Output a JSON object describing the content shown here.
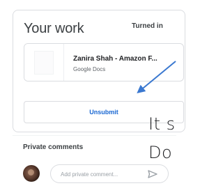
{
  "work_card": {
    "title": "Your work",
    "status": "Turned in",
    "attachment": {
      "title": "Zanira Shah - Amazon F...",
      "subtitle": "Google Docs"
    },
    "unsubmit_label": "Unsubmit"
  },
  "overlay_text": {
    "line1": "It s",
    "line2": "Do"
  },
  "private_comments": {
    "label": "Private comments",
    "placeholder": "Add private comment..."
  },
  "colors": {
    "accent": "#1967d2",
    "arrow": "#3a78d0",
    "border": "#dadce0"
  },
  "icons": [
    "send-icon",
    "arrow-annotation"
  ]
}
